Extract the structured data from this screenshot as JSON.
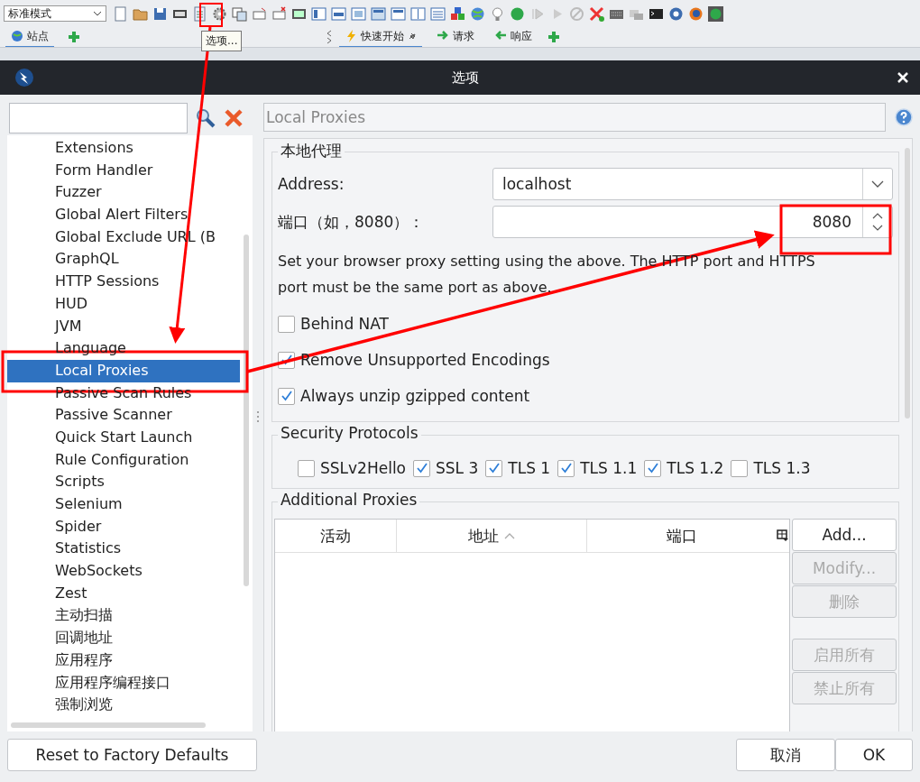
{
  "toolbar": {
    "mode_select": "标准模式",
    "tooltip": "选项..."
  },
  "left_tabs": [
    {
      "label": "站点",
      "selected": true
    }
  ],
  "right_tabs": [
    {
      "label": "快速开始",
      "selected": true,
      "kind": "start"
    },
    {
      "label": "请求",
      "selected": false,
      "kind": "request"
    },
    {
      "label": "响应",
      "selected": false,
      "kind": "response"
    }
  ],
  "dialog": {
    "title": "选项"
  },
  "tree": {
    "items": [
      {
        "label": "Extensions",
        "selected": false
      },
      {
        "label": "Form Handler",
        "selected": false
      },
      {
        "label": "Fuzzer",
        "selected": false
      },
      {
        "label": "Global Alert Filters",
        "selected": false
      },
      {
        "label": "Global Exclude URL (B",
        "selected": false
      },
      {
        "label": "GraphQL",
        "selected": false
      },
      {
        "label": "HTTP Sessions",
        "selected": false
      },
      {
        "label": "HUD",
        "selected": false
      },
      {
        "label": "JVM",
        "selected": false
      },
      {
        "label": "Language",
        "selected": false
      },
      {
        "label": "Local Proxies",
        "selected": true
      },
      {
        "label": "Passive Scan Rules",
        "selected": false
      },
      {
        "label": "Passive Scanner",
        "selected": false
      },
      {
        "label": "Quick Start Launch",
        "selected": false
      },
      {
        "label": "Rule Configuration",
        "selected": false
      },
      {
        "label": "Scripts",
        "selected": false
      },
      {
        "label": "Selenium",
        "selected": false
      },
      {
        "label": "Spider",
        "selected": false
      },
      {
        "label": "Statistics",
        "selected": false
      },
      {
        "label": "WebSockets",
        "selected": false
      },
      {
        "label": "Zest",
        "selected": false
      },
      {
        "label": "主动扫描",
        "selected": false
      },
      {
        "label": "回调地址",
        "selected": false
      },
      {
        "label": "应用程序",
        "selected": false
      },
      {
        "label": "应用程序编程接口",
        "selected": false
      },
      {
        "label": "强制浏览",
        "selected": false
      }
    ]
  },
  "reset_button": "Reset to Factory Defaults",
  "panel": {
    "title": "Local Proxies"
  },
  "local_proxy": {
    "legend": "本地代理",
    "address_label": "Address:",
    "address_value": "localhost",
    "port_label": "端口（如，8080）：",
    "port_value": "8080",
    "note": "Set your browser proxy setting using the above.  The HTTP port and HTTPS port must be the same port as above.",
    "options": [
      {
        "label": "Behind NAT",
        "checked": false
      },
      {
        "label": "Remove Unsupported Encodings",
        "checked": true
      },
      {
        "label": "Always unzip gzipped content",
        "checked": true
      }
    ]
  },
  "security_protocols": {
    "legend": "Security Protocols",
    "protocols": [
      {
        "label": "SSLv2Hello",
        "checked": false
      },
      {
        "label": "SSL 3",
        "checked": true
      },
      {
        "label": "TLS 1",
        "checked": true
      },
      {
        "label": "TLS 1.1",
        "checked": true
      },
      {
        "label": "TLS 1.2",
        "checked": true
      },
      {
        "label": "TLS 1.3",
        "checked": false
      }
    ]
  },
  "additional_proxies": {
    "legend": "Additional Proxies",
    "columns": [
      {
        "label": "活动",
        "sorted": false
      },
      {
        "label": "地址",
        "sorted": true
      },
      {
        "label": "端口",
        "sorted": false
      }
    ],
    "buttons": [
      {
        "label": "Add...",
        "disabled": false,
        "separated": false
      },
      {
        "label": "Modify...",
        "disabled": true,
        "separated": false
      },
      {
        "label": "删除",
        "disabled": true,
        "separated": false
      },
      {
        "label": "启用所有",
        "disabled": true,
        "separated": true
      },
      {
        "label": "禁止所有",
        "disabled": true,
        "separated": false
      }
    ]
  },
  "footer_buttons": [
    {
      "label": "取消"
    },
    {
      "label": "OK"
    }
  ]
}
